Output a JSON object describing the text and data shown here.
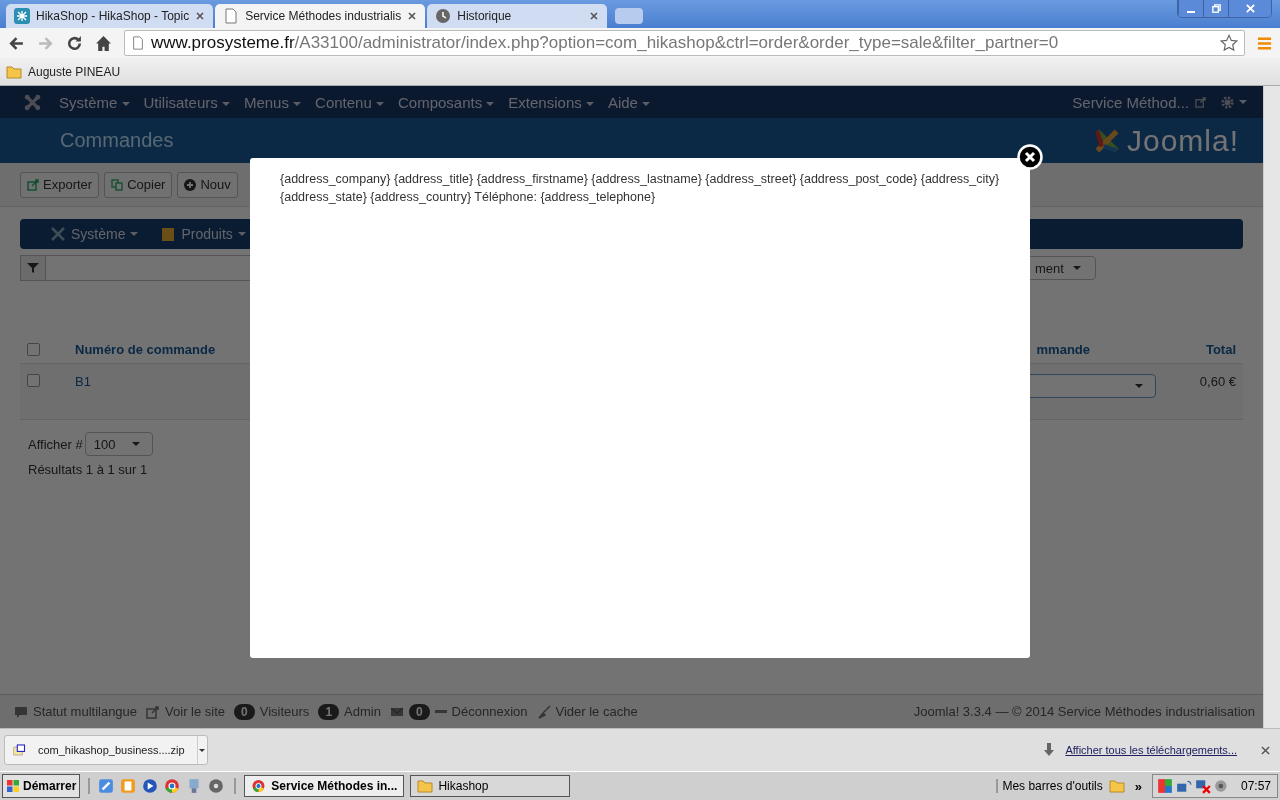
{
  "browser": {
    "tabs": [
      {
        "title": "HikaShop - HikaShop - Topic",
        "selected": false,
        "kind": "app"
      },
      {
        "title": "Service Méthodes industrialis",
        "selected": true,
        "kind": "page"
      },
      {
        "title": "Historique",
        "selected": false,
        "kind": "history"
      }
    ],
    "url_host": "www.prosysteme.fr",
    "url_path": "/A33100/administrator/index.php?option=com_hikashop&ctrl=order&order_type=sale&filter_partner=0",
    "bookmarks": [
      "Auguste PINEAU"
    ]
  },
  "admin": {
    "menu": [
      "Système",
      "Utilisateurs",
      "Menus",
      "Contenu",
      "Composants",
      "Extensions",
      "Aide"
    ],
    "site_link": "Service Méthod...",
    "page_title": "Commandes",
    "logo_text": "Joomla!",
    "toolbar": [
      {
        "kind": "export",
        "label": "Exporter"
      },
      {
        "kind": "copy",
        "label": "Copier"
      },
      {
        "kind": "new",
        "label": "Nouv"
      }
    ],
    "hika_menu": [
      {
        "kind": "system",
        "label": "Système"
      },
      {
        "kind": "products",
        "label": "Produits"
      }
    ],
    "filter_select": "ment",
    "table": {
      "header_checked": false,
      "columns": [
        "Numéro de commande",
        "mmande",
        "Total"
      ],
      "rows": [
        {
          "number": "B1",
          "total": "0,60 €",
          "checked": false
        }
      ]
    },
    "limit_label": "Afficher #",
    "limit_value": "100",
    "results": "Résultats 1 à 1 sur 1",
    "footer": [
      {
        "kind": "multilang",
        "label": "Statut multilangue"
      },
      {
        "kind": "site",
        "label": "Voir le site"
      },
      {
        "kind": "visitors",
        "count": "0",
        "label": "Visiteurs"
      },
      {
        "kind": "admins",
        "count": "1",
        "label": "Admin"
      },
      {
        "kind": "messages",
        "count": "0"
      },
      {
        "kind": "logout",
        "label": "Déconnexion"
      },
      {
        "kind": "cache",
        "label": "Vider le cache"
      }
    ],
    "footer_right": "Joomla! 3.3.4 — © 2014 Service Méthodes industrialisation"
  },
  "modal": {
    "text": "{address_company} {address_title} {address_firstname} {address_lastname} {address_street} {address_post_code} {address_city} {address_state} {address_country} Téléphone: {address_telephone}"
  },
  "downloads": {
    "file": "com_hikashop_business....zip",
    "show_all": "Afficher tous les téléchargements..."
  },
  "taskbar": {
    "start": "Démarrer",
    "windows": [
      {
        "title": "Service Méthodes in...",
        "selected": true,
        "kind": "browser"
      },
      {
        "title": "Hikashop",
        "selected": false,
        "kind": "explorer"
      }
    ],
    "toolbars": "Mes barres d'outils",
    "chevron": "»",
    "clock": "07:57"
  }
}
